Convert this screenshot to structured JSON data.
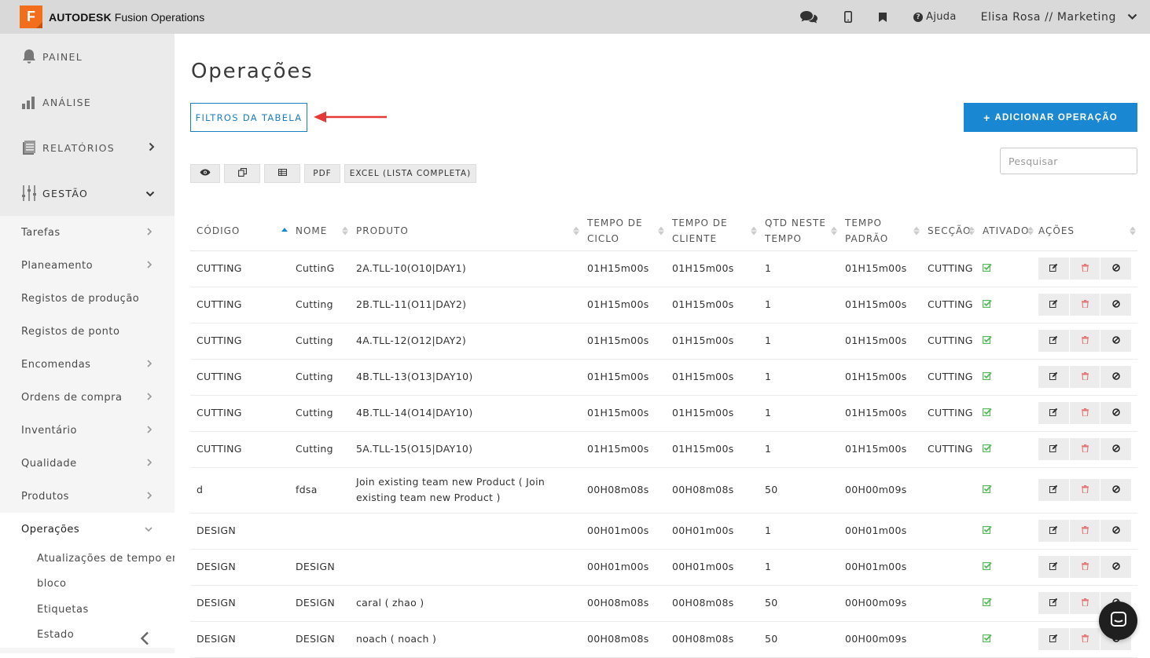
{
  "app": {
    "brand_bold": "AUTODESK",
    "brand_rest": " Fusion Operations",
    "logo_letter": "F",
    "brand_color": "#f26e1d"
  },
  "topbar": {
    "help_label": "Ajuda",
    "user_label": "Elisa Rosa // Marketing",
    "icons": [
      "chat-icon",
      "mobile-icon",
      "bookmark-icon",
      "help-icon",
      "chevron-down-icon"
    ]
  },
  "sidebar": {
    "main_items": [
      {
        "label": "PAINEL",
        "icon": "bell-icon"
      },
      {
        "label": "ANÁLISE",
        "icon": "bar-chart-icon"
      },
      {
        "label": "RELATÓRIOS",
        "icon": "report-icon"
      },
      {
        "label": "GESTÃO",
        "icon": "sliders-icon"
      }
    ],
    "sub_items": [
      {
        "label": "Tarefas"
      },
      {
        "label": "Planeamento"
      },
      {
        "label": "Registos de produção"
      },
      {
        "label": "Registos de ponto"
      },
      {
        "label": "Encomendas"
      },
      {
        "label": "Ordens de compra"
      },
      {
        "label": "Inventário"
      },
      {
        "label": "Qualidade"
      },
      {
        "label": "Produtos"
      },
      {
        "label": "Operações"
      }
    ],
    "leaf_items": [
      {
        "label": "Atualizações de tempo em"
      },
      {
        "label": "bloco"
      },
      {
        "label": "Etiquetas"
      },
      {
        "label": "Estado"
      }
    ]
  },
  "main": {
    "title": "Operações",
    "filters_label": "FILTROS DA TABELA",
    "add_label": "ADICIONAR OPERAÇÃO",
    "search_placeholder": "Pesquisar",
    "toolbar": {
      "pdf_label": "PDF",
      "excel_label": "EXCEL (LISTA COMPLETA)",
      "icons": [
        "eye-icon",
        "copy-icon",
        "table-icon"
      ]
    },
    "annotation_arrow_color": "#e53935",
    "accent_color": "#1a87d3"
  },
  "table": {
    "headers": {
      "code": "CÓDIGO",
      "name": "NOME",
      "product": "PRODUTO",
      "cycle_1": "TEMPO DE",
      "cycle_2": "CICLO",
      "client_1": "TEMPO DE",
      "client_2": "CLIENTE",
      "qty_1": "QTD NESTE",
      "qty_2": "TEMPO",
      "std_1": "TEMPO",
      "std_2": "PADRÃO",
      "section": "SECÇÃO",
      "active": "ATIVADO",
      "actions": "AÇÕES"
    },
    "rows": [
      {
        "code": "CUTTING",
        "name": "CuttinG",
        "product": "2A.TLL-10(O10|DAY1)",
        "cycle": "01H15m00s",
        "client": "01H15m00s",
        "qty": "1",
        "std": "01H15m00s",
        "section": "CUTTING",
        "active": true
      },
      {
        "code": "CUTTING",
        "name": "Cutting",
        "product": "2B.TLL-11(O11|DAY2)",
        "cycle": "01H15m00s",
        "client": "01H15m00s",
        "qty": "1",
        "std": "01H15m00s",
        "section": "CUTTING",
        "active": true
      },
      {
        "code": "CUTTING",
        "name": "Cutting",
        "product": "4A.TLL-12(O12|DAY2)",
        "cycle": "01H15m00s",
        "client": "01H15m00s",
        "qty": "1",
        "std": "01H15m00s",
        "section": "CUTTING",
        "active": true
      },
      {
        "code": "CUTTING",
        "name": "Cutting",
        "product": "4B.TLL-13(O13|DAY10)",
        "cycle": "01H15m00s",
        "client": "01H15m00s",
        "qty": "1",
        "std": "01H15m00s",
        "section": "CUTTING",
        "active": true
      },
      {
        "code": "CUTTING",
        "name": "Cutting",
        "product": "4B.TLL-14(O14|DAY10)",
        "cycle": "01H15m00s",
        "client": "01H15m00s",
        "qty": "1",
        "std": "01H15m00s",
        "section": "CUTTING",
        "active": true
      },
      {
        "code": "CUTTING",
        "name": "Cutting",
        "product": "5A.TLL-15(O15|DAY10)",
        "cycle": "01H15m00s",
        "client": "01H15m00s",
        "qty": "1",
        "std": "01H15m00s",
        "section": "CUTTING",
        "active": true
      },
      {
        "code": "d",
        "name": "fdsa",
        "product": "Join existing team new Product ( Join existing team new Product )",
        "cycle": "00H08m08s",
        "client": "00H08m08s",
        "qty": "50",
        "std": "00H00m09s",
        "section": "",
        "active": true
      },
      {
        "code": "DESIGN",
        "name": "",
        "product": "",
        "cycle": "00H01m00s",
        "client": "00H01m00s",
        "qty": "1",
        "std": "00H01m00s",
        "section": "",
        "active": true
      },
      {
        "code": "DESIGN",
        "name": "DESIGN",
        "product": "",
        "cycle": "00H01m00s",
        "client": "00H01m00s",
        "qty": "1",
        "std": "00H01m00s",
        "section": "",
        "active": true
      },
      {
        "code": "DESIGN",
        "name": "DESIGN",
        "product": "caral ( zhao )",
        "cycle": "00H08m08s",
        "client": "00H08m08s",
        "qty": "50",
        "std": "00H00m09s",
        "section": "",
        "active": true
      },
      {
        "code": "DESIGN",
        "name": "DESIGN",
        "product": "noach ( noach )",
        "cycle": "00H08m08s",
        "client": "00H08m08s",
        "qty": "50",
        "std": "00H00m09s",
        "section": "",
        "active": true
      }
    ],
    "action_icons": [
      "edit-icon",
      "delete-icon",
      "disable-icon"
    ],
    "active_color": "#5cb85c",
    "delete_color": "#e57373"
  }
}
